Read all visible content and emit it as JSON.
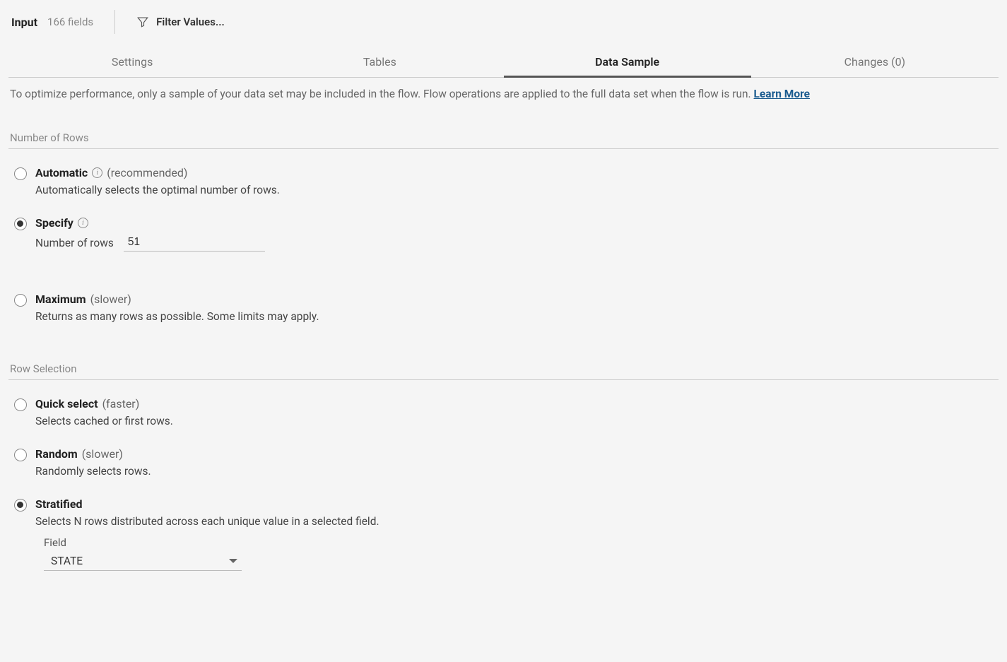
{
  "header": {
    "title": "Input",
    "fields_label": "166 fields",
    "filter_label": "Filter Values..."
  },
  "tabs": {
    "settings": "Settings",
    "tables": "Tables",
    "data_sample": "Data Sample",
    "changes": "Changes (0)"
  },
  "info": {
    "text": "To optimize performance, only a sample of your data set may be included in the flow. Flow operations are applied to the full data set when the flow is run.",
    "learn_more": "Learn More"
  },
  "sections": {
    "number_of_rows": {
      "title": "Number of Rows",
      "options": {
        "automatic": {
          "title": "Automatic",
          "hint": "(recommended)",
          "desc": "Automatically selects the optimal number of rows."
        },
        "specify": {
          "title": "Specify",
          "rows_label": "Number of rows",
          "rows_value": "51"
        },
        "maximum": {
          "title": "Maximum",
          "hint": "(slower)",
          "desc": "Returns as many rows as possible. Some limits may apply."
        }
      }
    },
    "row_selection": {
      "title": "Row Selection",
      "options": {
        "quick": {
          "title": "Quick select",
          "hint": "(faster)",
          "desc": "Selects cached or first rows."
        },
        "random": {
          "title": "Random",
          "hint": "(slower)",
          "desc": "Randomly selects rows."
        },
        "stratified": {
          "title": "Stratified",
          "desc": "Selects N rows distributed across each unique value in a selected field.",
          "field_label": "Field",
          "field_value": "STATE"
        }
      }
    }
  }
}
